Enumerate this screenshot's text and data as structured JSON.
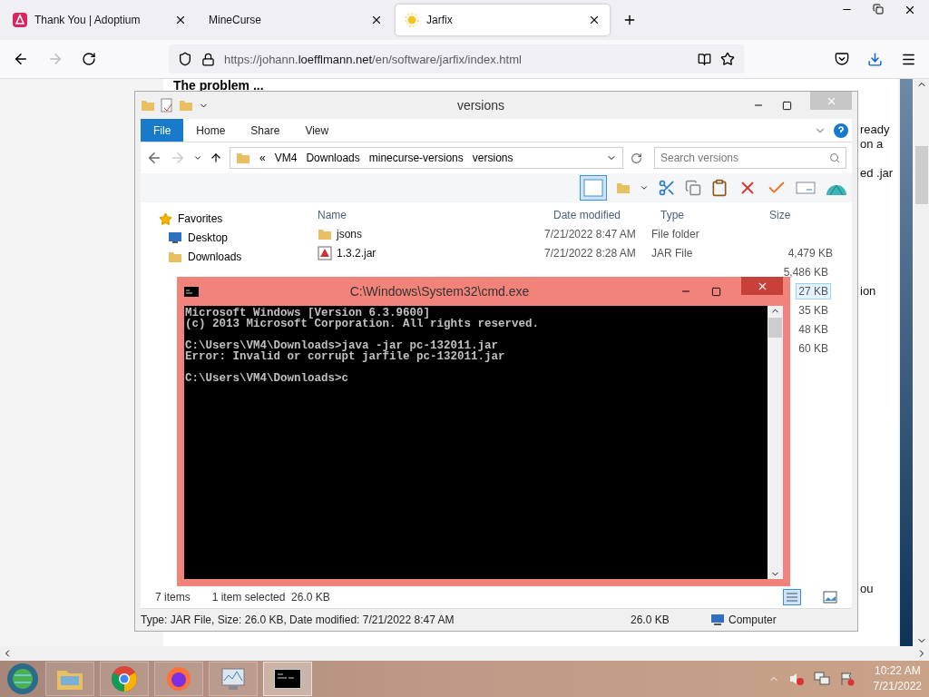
{
  "browser": {
    "tabs": [
      {
        "title": "Thank You | Adoptium",
        "kind": "adoptium",
        "selected": false
      },
      {
        "title": "MineCurse",
        "kind": "none",
        "selected": false
      },
      {
        "title": "Jarfix",
        "kind": "sun",
        "selected": true
      }
    ],
    "url": {
      "prefix": "https://johann.",
      "domain": "loefflmann.net",
      "path": "/en/software/jarfix/index.html"
    }
  },
  "page": {
    "heading": "The problem ...",
    "fragments": [
      "ready",
      "on a",
      "ed .jar",
      "ion",
      "ou"
    ]
  },
  "explorer": {
    "title": "versions",
    "ribbon_tabs": [
      {
        "label": "File",
        "selected": true
      },
      {
        "label": "Home",
        "selected": false
      },
      {
        "label": "Share",
        "selected": false
      },
      {
        "label": "View",
        "selected": false
      }
    ],
    "breadcrumb": [
      "«",
      "VM4",
      "Downloads",
      "minecurse-versions",
      "versions"
    ],
    "search": {
      "placeholder": "Search versions"
    },
    "columns": [
      "Name",
      "Date modified",
      "Type",
      "Size"
    ],
    "sidebar": [
      {
        "label": "Favorites",
        "kind": "star"
      },
      {
        "label": "Desktop",
        "kind": "desktop"
      },
      {
        "label": "Downloads",
        "kind": "downloads"
      }
    ],
    "rows": [
      {
        "name": "jsons",
        "date": "7/21/2022 8:47 AM",
        "type": "File folder",
        "kind": "folder"
      },
      {
        "name": "1.3.2.jar",
        "date": "7/21/2022 8:28 AM",
        "type": "JAR File",
        "size": "4,479 KB",
        "kind": "jar"
      }
    ],
    "covered_sizes": [
      {
        "size": "5,486 KB",
        "selected": false
      },
      {
        "size": "27 KB",
        "selected": true
      },
      {
        "size": "35 KB",
        "selected": false
      },
      {
        "size": "48 KB",
        "selected": false
      },
      {
        "size": "60 KB",
        "selected": false
      }
    ],
    "status": {
      "count": "7 items",
      "selection": "1 item selected  26.0 KB"
    },
    "details": {
      "summary": "Type: JAR File, Size: 26.0 KB, Date modified: 7/21/2022 8:47 AM",
      "size": "26.0 KB",
      "location": "Computer"
    }
  },
  "cmd": {
    "title": "C:\\Windows\\System32\\cmd.exe",
    "blocks": [
      [
        "Microsoft Windows [Version 6.3.9600]",
        "(c) 2013 Microsoft Corporation. All rights reserved."
      ],
      [
        "C:\\Users\\VM4\\Downloads>java -jar pc-132011.jar",
        "Error: Invalid or corrupt jarfile pc-132011.jar"
      ],
      [
        "C:\\Users\\VM4\\Downloads>c"
      ]
    ]
  },
  "taskbar": {
    "apps": [
      {
        "kind": "explorer",
        "selected": false
      },
      {
        "kind": "chrome",
        "selected": false
      },
      {
        "kind": "firefox",
        "selected": false
      },
      {
        "kind": "monitor",
        "selected": false
      },
      {
        "kind": "cmd",
        "selected": true
      }
    ],
    "time": "10:22 AM",
    "date": "7/21/2022"
  }
}
